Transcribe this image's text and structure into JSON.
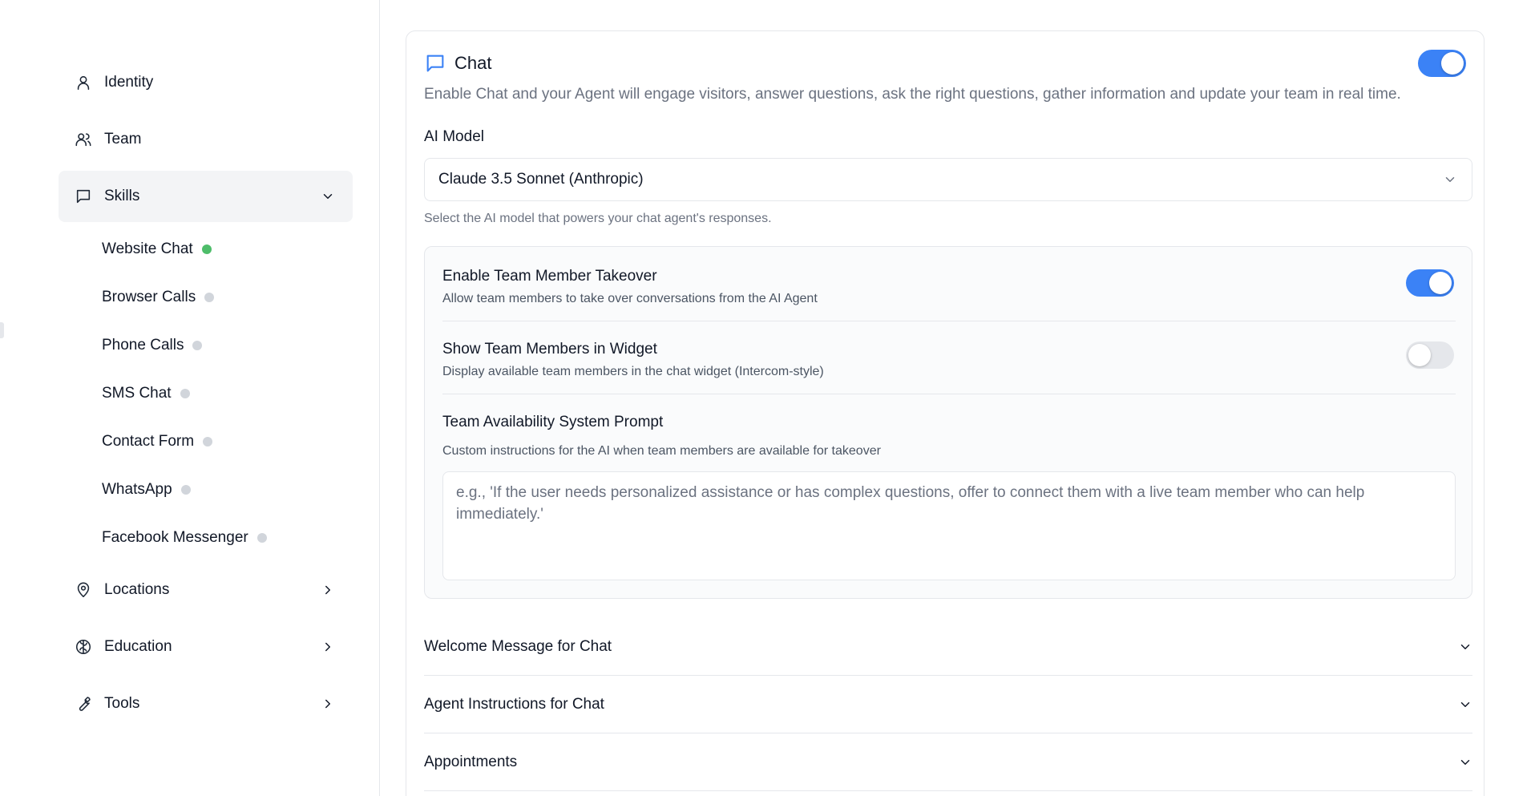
{
  "sidebar": {
    "nav": [
      {
        "label": "Identity",
        "icon": "user-icon"
      },
      {
        "label": "Team",
        "icon": "users-icon"
      },
      {
        "label": "Skills",
        "icon": "message-square-icon"
      },
      {
        "label": "Locations",
        "icon": "map-pin-icon"
      },
      {
        "label": "Education",
        "icon": "brain-icon"
      },
      {
        "label": "Tools",
        "icon": "wrench-icon"
      }
    ],
    "skills": [
      {
        "label": "Website Chat",
        "active": true
      },
      {
        "label": "Browser Calls",
        "active": false
      },
      {
        "label": "Phone Calls",
        "active": false
      },
      {
        "label": "SMS Chat",
        "active": false
      },
      {
        "label": "Contact Form",
        "active": false
      },
      {
        "label": "WhatsApp",
        "active": false
      },
      {
        "label": "Facebook Messenger",
        "active": false
      }
    ]
  },
  "chat": {
    "title": "Chat",
    "enabled": true,
    "description": "Enable Chat and your Agent will engage visitors, answer questions, ask the right questions, gather information and update your team in real time.",
    "ai_model": {
      "label": "AI Model",
      "value": "Claude 3.5 Sonnet (Anthropic)",
      "help": "Select the AI model that powers your chat agent's responses."
    },
    "takeover": {
      "title": "Enable Team Member Takeover",
      "description": "Allow team members to take over conversations from the AI Agent",
      "enabled": true
    },
    "show_team": {
      "title": "Show Team Members in Widget",
      "description": "Display available team members in the chat widget (Intercom-style)",
      "enabled": false
    },
    "prompt": {
      "title": "Team Availability System Prompt",
      "description": "Custom instructions for the AI when team members are available for takeover",
      "value": "",
      "placeholder": "e.g., 'If the user needs personalized assistance or has complex questions, offer to connect them with a live team member who can help immediately.'"
    },
    "sections": [
      {
        "label": "Welcome Message for Chat"
      },
      {
        "label": "Agent Instructions for Chat"
      },
      {
        "label": "Appointments"
      }
    ]
  },
  "colors": {
    "accent": "#3b82f6",
    "status_on": "#4ebd6a",
    "status_off": "#d1d5db"
  }
}
